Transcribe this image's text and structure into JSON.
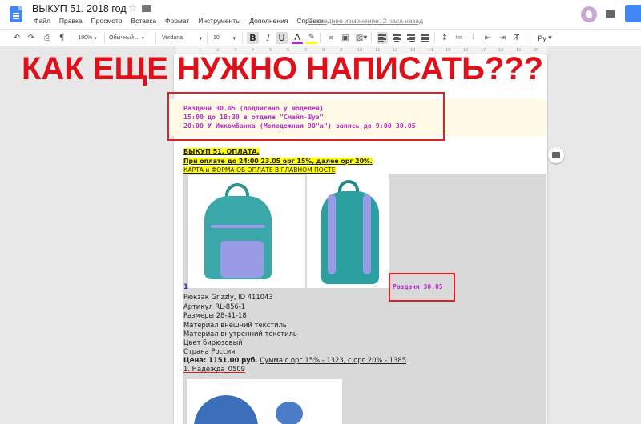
{
  "document": {
    "title": "ВЫКУП 51.  2018 год",
    "last_edit": "Последнее изменение: 2 часа назад"
  },
  "menu": [
    "Файл",
    "Правка",
    "Просмотр",
    "Вставка",
    "Формат",
    "Инструменты",
    "Дополнения",
    "Справка"
  ],
  "toolbar": {
    "zoom": "100%",
    "style": "Обычный ...",
    "font": "Verdana",
    "font_size": "10",
    "bold": "B",
    "italic": "I",
    "underline": "U",
    "text_color": "A",
    "language": "Ру"
  },
  "ruler": {
    "ticks": [
      "1",
      "2",
      "3",
      "4",
      "5",
      "6",
      "7",
      "8",
      "9",
      "10",
      "11",
      "12",
      "13",
      "14",
      "15",
      "16",
      "17",
      "18",
      "19",
      "20"
    ]
  },
  "annotation": {
    "caption": "КАК ЕЩЕ НУЖНО НАПИСАТЬ???"
  },
  "notice": {
    "line1": "Раздачи 30.05 (подписано у моделей)",
    "line2": "15:00 до 18:30 в отделе \"Смайл-Шуз\"",
    "line3": "20:00 У Ижкомбанка (Молодежная 90\"а\") запись до 9:00 30.05"
  },
  "payment": {
    "heading": "ВЫКУП 51. ОПЛАТА.",
    "terms": "При оплате до 24:00 23.05 орг 15%, далее орг 20%.",
    "link": "КАРТА и ФОРМА ОБ ОПЛАТЕ В ГЛАВНОМ ПОСТЕ"
  },
  "product": {
    "number": "1",
    "distribution_label": "Раздачи 30.05",
    "name": "Рюкзак Grizzly, ID 411043",
    "article": "Артикул RL-856-1",
    "sizes": "Размеры 28-41-18",
    "material_outer": "Материал внешний текстиль",
    "material_inner": "Материал внутренний текстиль",
    "color": "Цвет бирюзовый",
    "country": "Страна Россия",
    "price_label": "Цена: 1151.00 руб.",
    "price_detail": "Сумма с орг 15% - 1323, с орг 20% - 1385",
    "buyer": "1. Надежда_0509"
  },
  "colors": {
    "accent_red": "#e0101a",
    "notice_purple": "#b030c8",
    "highlight_yellow": "#ffff00",
    "docs_blue": "#4285f4"
  }
}
